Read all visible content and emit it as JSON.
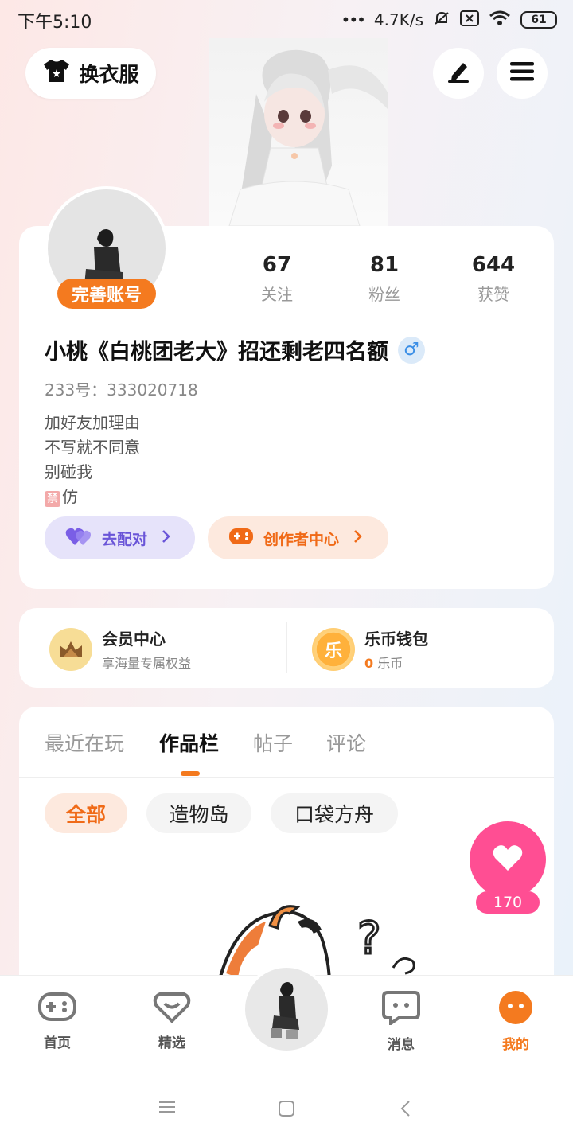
{
  "status_bar": {
    "time": "下午5:10",
    "network_speed": "4.7K/s",
    "battery": "61"
  },
  "header": {
    "outfit_label": "换衣服",
    "icons": [
      "shirt-icon",
      "edit-icon",
      "menu-icon"
    ]
  },
  "profile": {
    "complete_badge": "完善账号",
    "stats": [
      {
        "value": "67",
        "label": "关注"
      },
      {
        "value": "81",
        "label": "粉丝"
      },
      {
        "value": "644",
        "label": "获赞"
      }
    ],
    "username": "小桃《白桃团老大》招还剩老四名额",
    "gender_symbol": "♂",
    "user_id": "233号：333020718",
    "bio_lines": [
      "加好友加理由",
      "不写就不同意",
      "别碰我"
    ],
    "bio_ban_glyph": "禁",
    "bio_ban_text": "仿",
    "pair_button": "去配对",
    "creator_button": "创作者中心"
  },
  "wallet": {
    "vip_title": "会员中心",
    "vip_sub": "享海量专属权益",
    "coin_title": "乐币钱包",
    "coin_glyph": "乐",
    "coin_amount": "0",
    "coin_unit": "乐币"
  },
  "content": {
    "tabs": [
      "最近在玩",
      "作品栏",
      "帖子",
      "评论"
    ],
    "active_tab": 1,
    "chips": [
      "全部",
      "造物岛",
      "口袋方舟"
    ],
    "active_chip": 0,
    "like_count": "170"
  },
  "bottom_nav": {
    "items": [
      {
        "label": "首页",
        "icon": "gamepad-icon"
      },
      {
        "label": "精选",
        "icon": "heart-box-icon"
      },
      {
        "label": "消息",
        "icon": "chat-icon"
      },
      {
        "label": "我的",
        "icon": "face-icon"
      }
    ],
    "active": 3
  },
  "colors": {
    "accent": "#f47a1f",
    "like_pink": "#ff4e93",
    "pair_purple": "#6a55d8"
  }
}
